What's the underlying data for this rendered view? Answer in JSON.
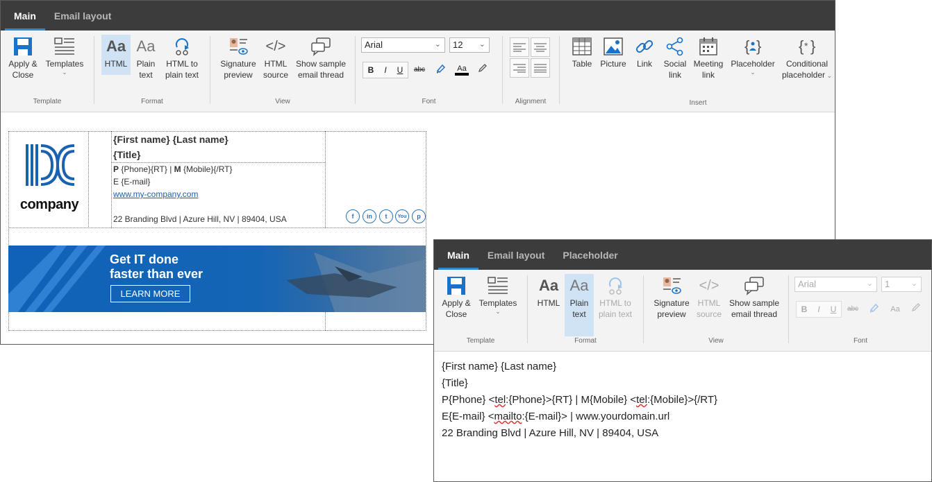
{
  "win1": {
    "tabs": [
      "Main",
      "Email layout"
    ],
    "groups": {
      "template": "Template",
      "format": "Format",
      "view": "View",
      "font": "Font",
      "alignment": "Alignment",
      "insert": "Insert"
    },
    "buttons": {
      "apply_close": [
        "Apply &",
        "Close"
      ],
      "templates": "Templates",
      "html": "HTML",
      "plain_text": [
        "Plain",
        "text"
      ],
      "html_to_plain": [
        "HTML to",
        "plain text"
      ],
      "signature_preview": [
        "Signature",
        "preview"
      ],
      "html_source": [
        "HTML",
        "source"
      ],
      "show_sample": [
        "Show sample",
        "email thread"
      ],
      "table": "Table",
      "picture": "Picture",
      "link": "Link",
      "social_link": [
        "Social",
        "link"
      ],
      "meeting_link": [
        "Meeting",
        "link"
      ],
      "placeholder": "Placeholder",
      "conditional_placeholder": [
        "Conditional",
        "placeholder"
      ]
    },
    "font_name": "Arial",
    "font_size": "12",
    "format_buttons": [
      "B",
      "I",
      "U",
      "abc",
      "Aa"
    ],
    "signature": {
      "name": "{First name} {Last name}",
      "title": "{Title}",
      "phone_p": "P",
      "phone_rest": "{Phone}{RT} | ",
      "phone_m": "M",
      "phone_mobile": "{Mobile}{/RT}",
      "email_e": "E",
      "email_rest": "{E-mail}",
      "website": "www.my-company.com",
      "address": "22 Branding Blvd | Azure Hill, NV | 89404, USA",
      "logo_text": "company",
      "social": [
        "f",
        "in",
        "t",
        "You",
        "p"
      ]
    },
    "banner": {
      "line1": "Get IT done",
      "line2": "faster than ever",
      "cta": "LEARN MORE"
    },
    "colors": {
      "accent": "#2a8ad6",
      "brand": "#1a62b0",
      "tabbar": "#3c3c3c"
    }
  },
  "win2": {
    "tabs": [
      "Main",
      "Email layout",
      "Placeholder"
    ],
    "groups": {
      "template": "Template",
      "format": "Format",
      "view": "View",
      "font": "Font"
    },
    "buttons": {
      "apply_close": [
        "Apply &",
        "Close"
      ],
      "templates": "Templates",
      "html": "HTML",
      "plain_text": [
        "Plain",
        "text"
      ],
      "html_to_plain": [
        "HTML to",
        "plain text"
      ],
      "signature_preview": [
        "Signature",
        "preview"
      ],
      "html_source": [
        "HTML",
        "source"
      ],
      "show_sample": [
        "Show sample",
        "email thread"
      ]
    },
    "font_name": "Arial",
    "font_size": "1",
    "format_buttons": [
      "B",
      "I",
      "U",
      "abc",
      "Aa"
    ],
    "plaintext": {
      "line1": "{First name} {Last name}",
      "line2": "{Title}",
      "line3a": "P{Phone} <",
      "line3b": "tel",
      "line3c": ":{Phone}>{RT} | M{Mobile} <",
      "line3d": "tel",
      "line3e": ":{Mobile}>{/RT}",
      "line4a": "E{E-mail} <",
      "line4b": "mailto",
      "line4c": ":{E-mail}> | www.yourdomain.url",
      "line5": "22 Branding Blvd | Azure Hill, NV | 89404, USA"
    }
  }
}
